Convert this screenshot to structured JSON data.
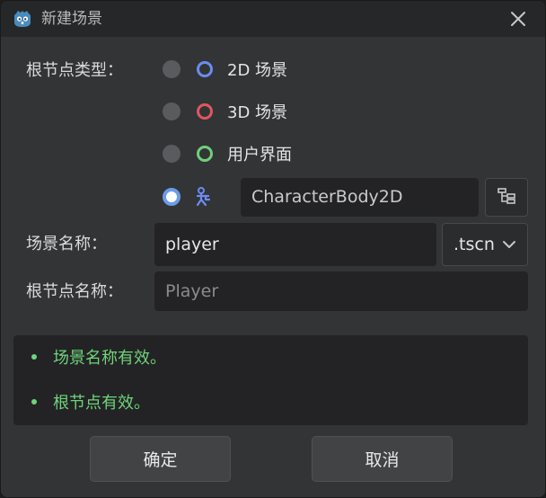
{
  "window": {
    "title": "新建场景",
    "app_icon": "godot-icon",
    "close_icon": "close-icon"
  },
  "root_type": {
    "label": "根节点类型：",
    "options": [
      {
        "label": "2D 场景",
        "icon": "node2d-icon",
        "icon_color": "#6b8cf0",
        "checked": false
      },
      {
        "label": "3D 场景",
        "icon": "node3d-icon",
        "icon_color": "#e0575f",
        "checked": false
      },
      {
        "label": "用户界面",
        "icon": "control-icon",
        "icon_color": "#6ed07c",
        "checked": false
      },
      {
        "label": "CharacterBody2D",
        "icon": "characterbody2d-icon",
        "icon_color": "#6b8cf0",
        "checked": true
      }
    ],
    "browse_icon": "node-tree-icon"
  },
  "scene_name": {
    "label": "场景名称：",
    "value": "player",
    "extension": ".tscn",
    "dropdown_icon": "chevron-down-icon"
  },
  "root_name": {
    "label": "根节点名称：",
    "placeholder": "Player"
  },
  "messages": [
    "场景名称有效。",
    "根节点有效。"
  ],
  "buttons": {
    "ok": "确定",
    "cancel": "取消"
  },
  "colors": {
    "accent": "#699ce8",
    "valid": "#6fd47a",
    "background": "#333436"
  }
}
